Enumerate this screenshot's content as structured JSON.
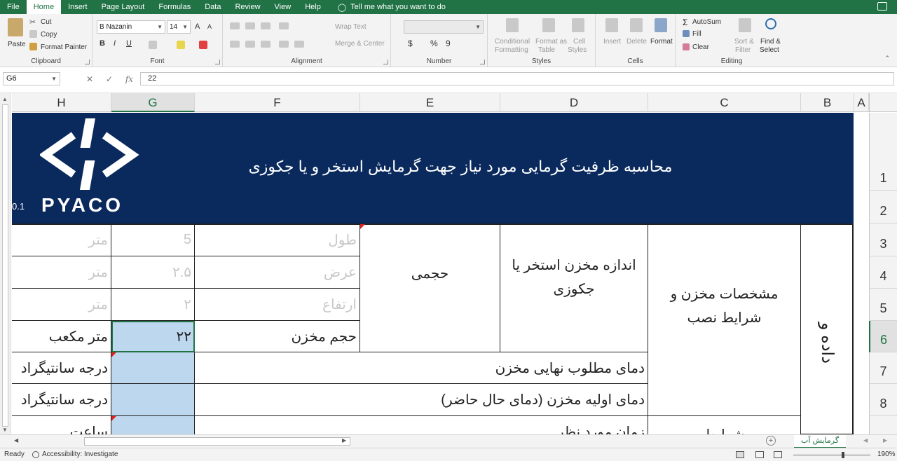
{
  "menu": {
    "tabs": [
      "File",
      "Home",
      "Insert",
      "Page Layout",
      "Formulas",
      "Data",
      "Review",
      "View",
      "Help"
    ],
    "active": "Home",
    "tell_me": "Tell me what you want to do"
  },
  "ribbon": {
    "clipboard": {
      "title": "Clipboard",
      "paste": "Paste",
      "cut": "Cut",
      "copy": "Copy",
      "format_painter": "Format Painter"
    },
    "font": {
      "title": "Font",
      "name": "B Nazanin",
      "size": "14",
      "bold": "B",
      "italic": "I",
      "underline": "U",
      "grow": "A",
      "shrink": "A"
    },
    "alignment": {
      "title": "Alignment",
      "wrap_text": "Wrap Text",
      "merge_center": "Merge & Center"
    },
    "number": {
      "title": "Number",
      "currency": "$",
      "percent": "%",
      "comma": "9"
    },
    "styles": {
      "title": "Styles",
      "conditional": "Conditional",
      "formatting": "Formatting",
      "format_as": "Format as",
      "table": "Table",
      "cell": "Cell",
      "styles_lbl": "Styles"
    },
    "cells": {
      "title": "Cells",
      "insert": "Insert",
      "delete": "Delete",
      "format": "Format"
    },
    "editing": {
      "title": "Editing",
      "autosum": "AutoSum",
      "fill": "Fill",
      "clear": "Clear",
      "sort": "Sort &",
      "filter": "Filter",
      "find": "Find &",
      "select": "Select"
    }
  },
  "formula_bar": {
    "name_box": "G6",
    "value": "22",
    "fx": "fx"
  },
  "columns": [
    "H",
    "G",
    "F",
    "E",
    "D",
    "C",
    "B",
    "A"
  ],
  "rows": [
    "1",
    "2",
    "3",
    "4",
    "5",
    "6",
    "7",
    "8"
  ],
  "banner": {
    "title": "محاسبه ظرفیت گرمایی مورد نیاز جهت گرمایش استخر و یا جکوزی",
    "version": "0.1",
    "brand": "PYACO"
  },
  "cells": {
    "h3": "متر",
    "g3": "5",
    "f3": "طول",
    "h4": "متر",
    "g4": "۲.۵",
    "f4": "عرض",
    "h5": "متر",
    "g5": "۲",
    "f5": "ارتفاع",
    "h6": "متر مکعب",
    "g6": "۲۲",
    "f6": "حجم مخزن",
    "e3": "حجمی",
    "d3": "اندازه مخزن استخر یا جکوزی",
    "c3": "مشخصات مخزن و شرایط نصب",
    "b_side": "داده و",
    "h7": "درجه سانتیگراد",
    "f7": "دمای مطلوب نهایی مخزن",
    "h8": "درجه سانتیگراد",
    "f8": "دمای اولیه مخزن (دمای حال حاضر)",
    "h9": "ساعت",
    "f9": "زمان مورد نظر",
    "c9": "شرایط"
  },
  "sheet_tab": "گرمایش آب",
  "status": {
    "ready": "Ready",
    "accessibility": "Accessibility: Investigate",
    "zoom": "190%"
  },
  "colors": {
    "excel_green": "#217346",
    "banner": "#0a2a5e",
    "input_blue": "#bdd7ee"
  }
}
